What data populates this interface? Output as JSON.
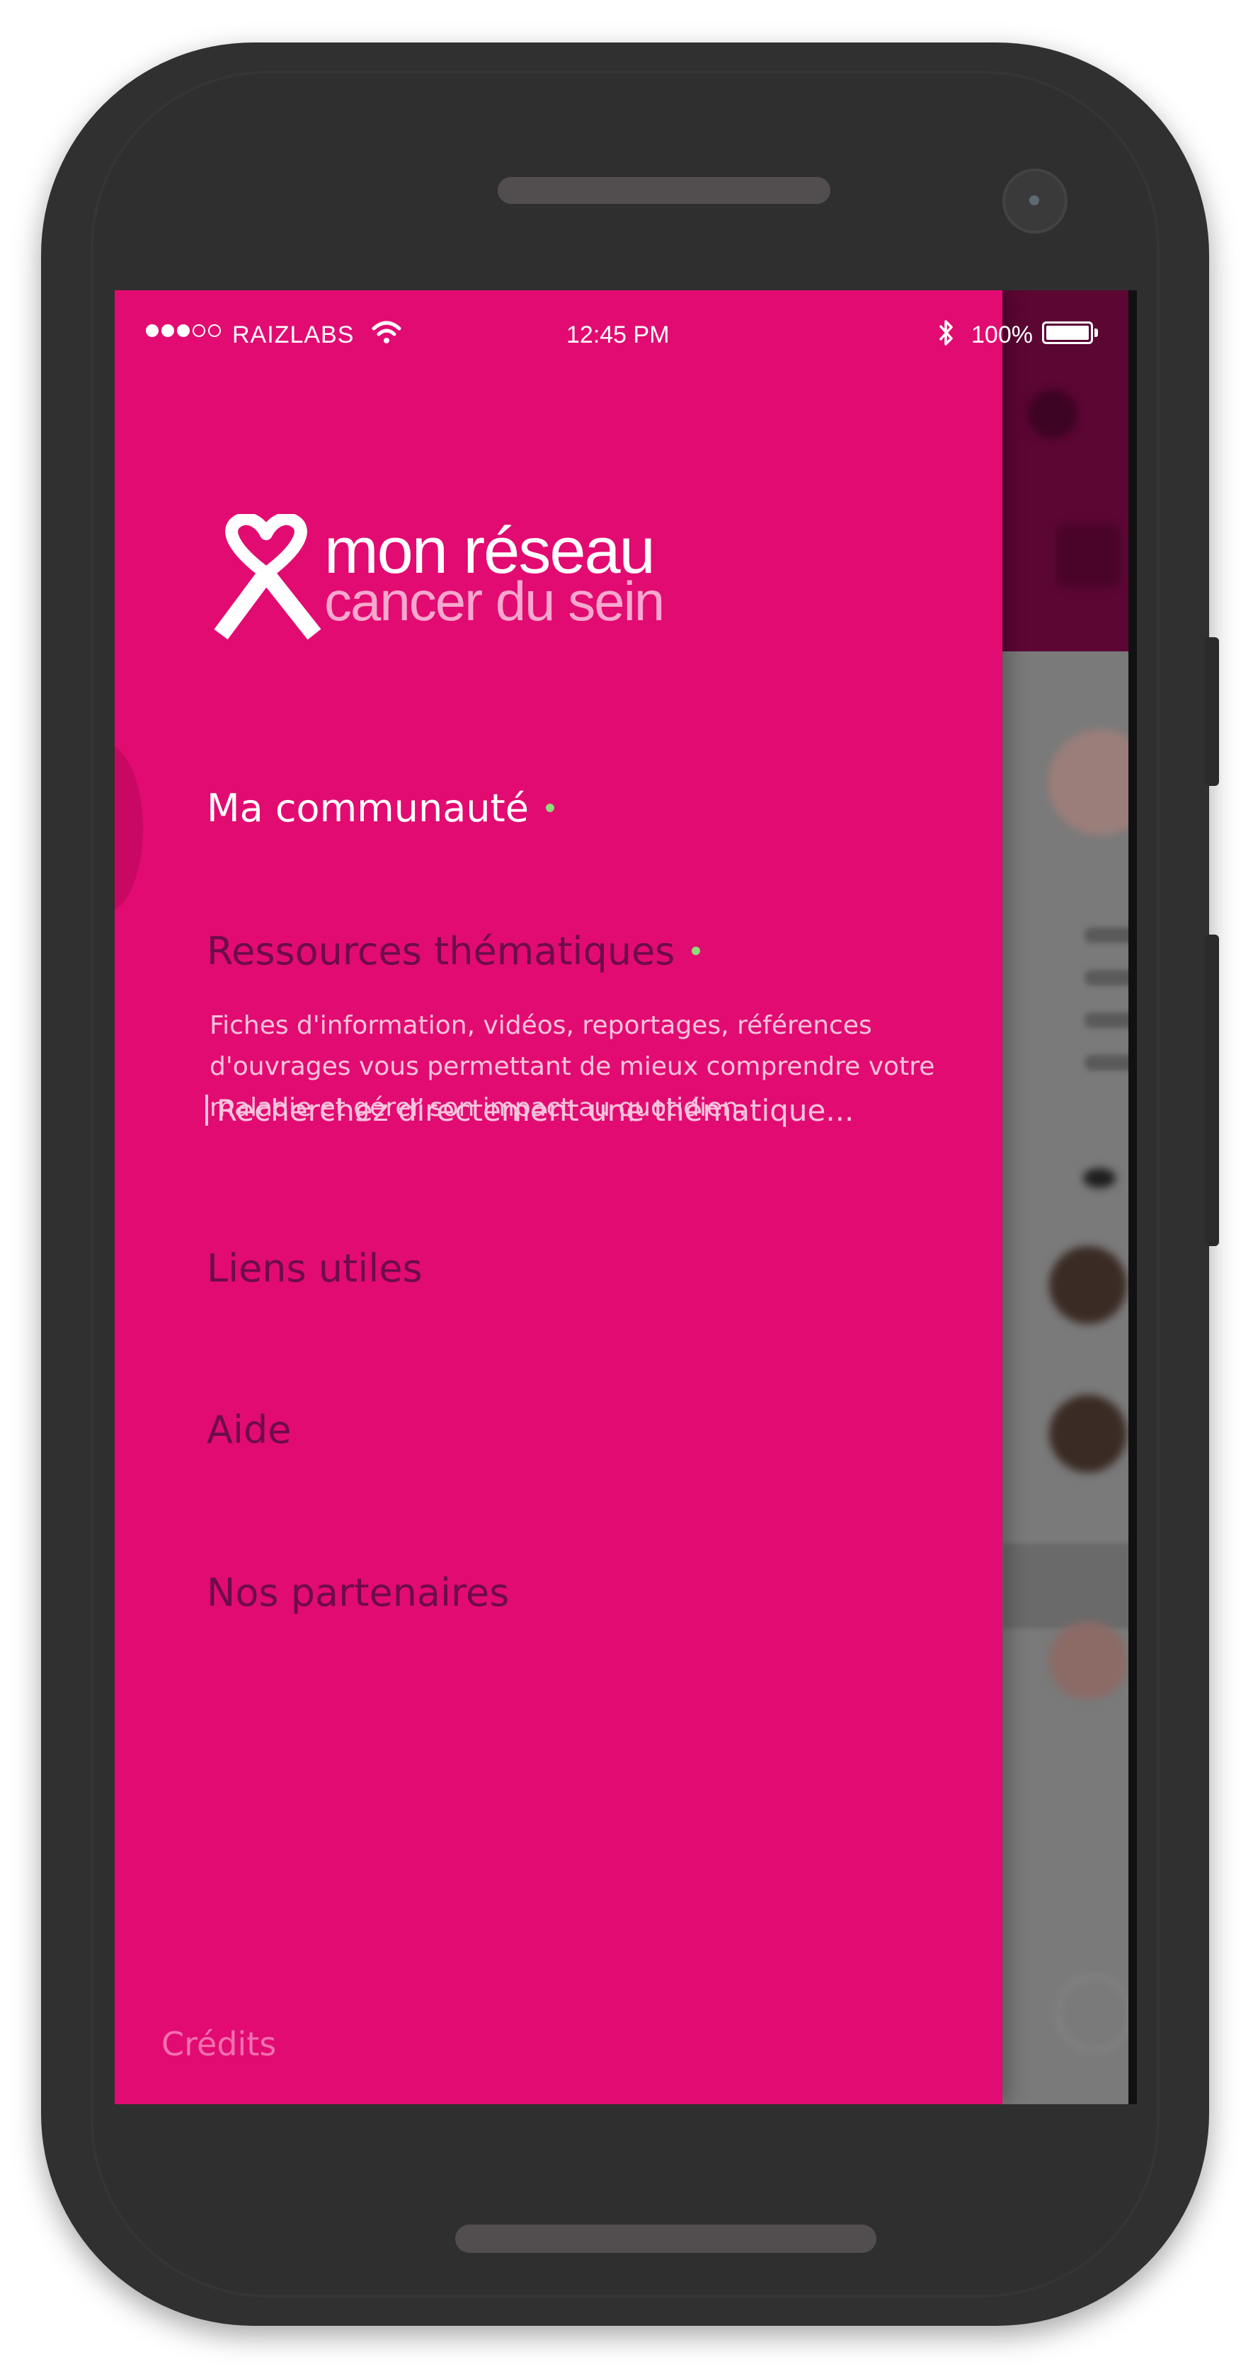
{
  "status_bar": {
    "carrier": "RAIZLABS",
    "time": "12:45 PM",
    "battery": "100%",
    "signal_dots_filled": 3,
    "signal_dots_total": 5
  },
  "logo": {
    "line1": "mon réseau",
    "line2": "cancer du sein"
  },
  "menu": {
    "community": "Ma communauté",
    "resources": "Ressources thématiques",
    "resources_description": "Fiches d'information, vidéos, reportages, références d'ouvrages vous permettant de mieux comprendre votre maladie et gérer son impact au quotidien.",
    "search_placeholder": "Recherchez directement une thématique...",
    "useful_links": "Liens utiles",
    "help": "Aide",
    "partners": "Nos partenaires",
    "credits": "Crédits"
  },
  "colors": {
    "drawer_background": "#e20b71",
    "active_text": "#ffffff",
    "inactive_text": "#6c0c4a",
    "indicator_dot": "#8edb7b",
    "description_text": "#f7c4dd",
    "credits_text": "#f36fb0"
  }
}
